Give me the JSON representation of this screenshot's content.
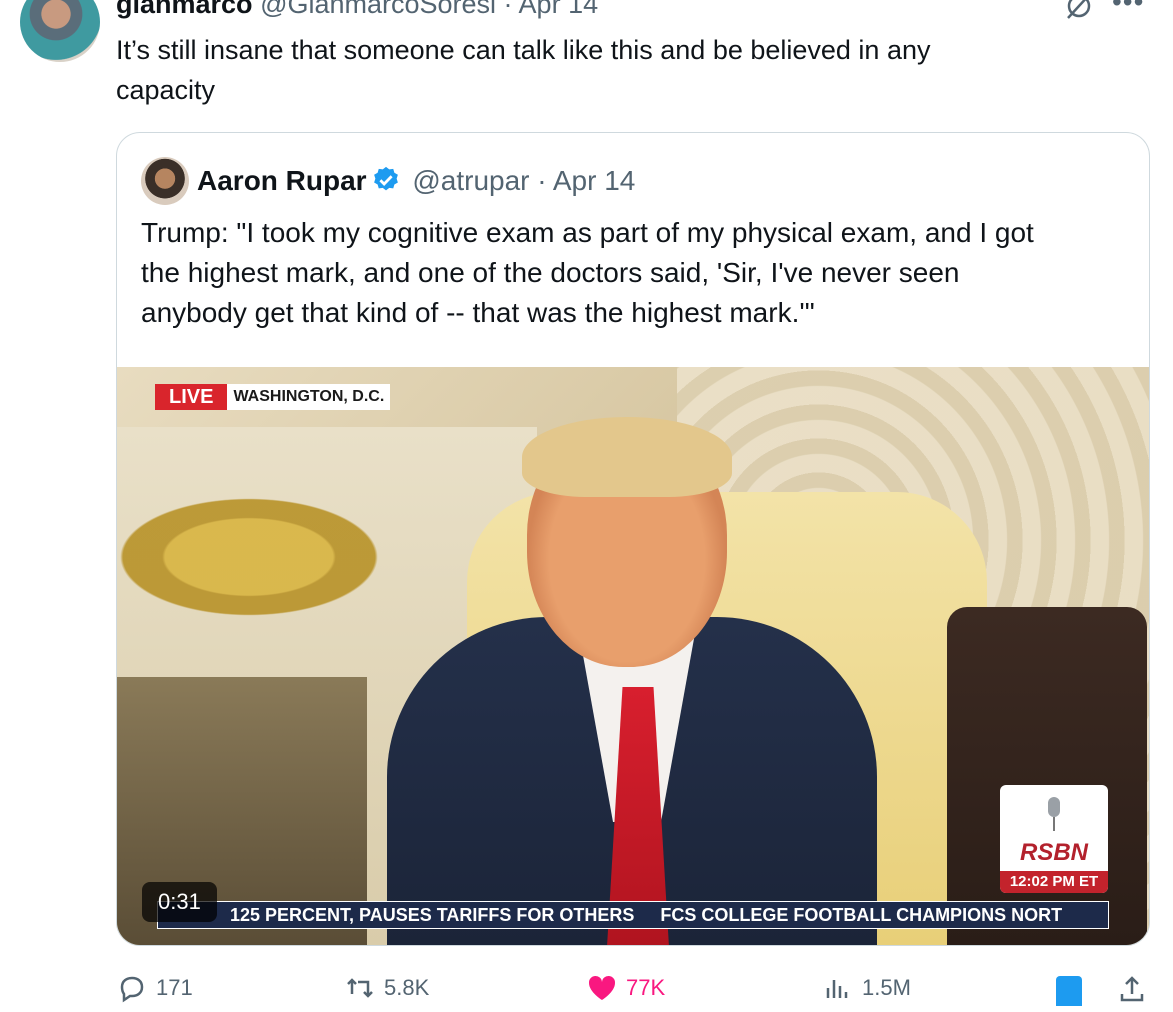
{
  "tweet": {
    "author_name": "gianmarco",
    "author_meta": "@GianmarcoSoresi · Apr 14",
    "text": "It’s still insane that someone can talk like this and be believed in any\ncapacity"
  },
  "quote": {
    "name": "Aaron Rupar",
    "meta": "@atrupar · Apr 14",
    "text": "Trump: \"I took my cognitive exam as part of my physical exam, and I got\nthe highest mark, and one of the doctors said, 'Sir, I've never seen\nanybody get that kind of -- that was the highest mark.'\""
  },
  "video": {
    "live_label": "LIVE",
    "location": "WASHINGTON, D.C.",
    "network_logo": "RSBN",
    "time": "12:02 PM ET",
    "ticker_1": "125 PERCENT, PAUSES TARIFFS FOR OTHERS",
    "ticker_2": "FCS COLLEGE FOOTBALL CHAMPIONS NORT",
    "duration": "0:31"
  },
  "actions": {
    "replies": "171",
    "reposts": "5.8K",
    "likes": "77K",
    "views": "1.5M"
  },
  "colors": {
    "accent": "#1d9bf0",
    "like": "#f91880",
    "muted": "#536471",
    "live_red": "#d9252c"
  }
}
